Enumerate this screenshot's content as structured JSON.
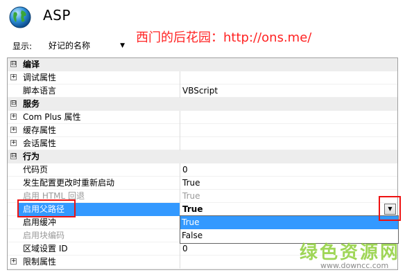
{
  "header": {
    "title": "ASP",
    "watermark": "西门的后花园：http://ons.me/"
  },
  "sortbar": {
    "label": "显示:",
    "selected": "好记的名称"
  },
  "rows": [
    {
      "kind": "category",
      "expander": "⊟",
      "name": "编译"
    },
    {
      "kind": "prop",
      "expander": "+",
      "name": "调试属性",
      "value": ""
    },
    {
      "kind": "prop",
      "name": "脚本语言",
      "value": "VBScript"
    },
    {
      "kind": "category",
      "expander": "⊟",
      "name": "服务"
    },
    {
      "kind": "prop",
      "expander": "+",
      "name": "Com Plus 属性",
      "value": ""
    },
    {
      "kind": "prop",
      "expander": "+",
      "name": "缓存属性",
      "value": ""
    },
    {
      "kind": "prop",
      "expander": "+",
      "name": "会话属性",
      "value": ""
    },
    {
      "kind": "category",
      "expander": "⊟",
      "name": "行为"
    },
    {
      "kind": "prop",
      "name": "代码页",
      "value": "0"
    },
    {
      "kind": "prop",
      "name": "发生配置更改时重新启动",
      "value": "True"
    },
    {
      "kind": "prop",
      "disabled": true,
      "name": "启用 HTML 回退",
      "value": "True"
    },
    {
      "kind": "prop",
      "selected": true,
      "name": "启用父路径",
      "value": "True"
    },
    {
      "kind": "prop",
      "name": "启用缓冲",
      "value": ""
    },
    {
      "kind": "prop",
      "disabled": true,
      "name": "启用块编码",
      "value": ""
    },
    {
      "kind": "prop",
      "name": "区域设置 ID",
      "value": "0"
    },
    {
      "kind": "prop",
      "expander": "+",
      "name": "限制属性",
      "value": ""
    }
  ],
  "dropdown": {
    "options": [
      "True",
      "False"
    ],
    "active_index": 0
  },
  "site_logo": {
    "name": "绿色资源网",
    "url": "www.downcc.com"
  },
  "colors": {
    "selection": "#3399ff",
    "highlight": "#ee1111",
    "watermark": "#ff2222",
    "category_bg": "#ededed"
  }
}
